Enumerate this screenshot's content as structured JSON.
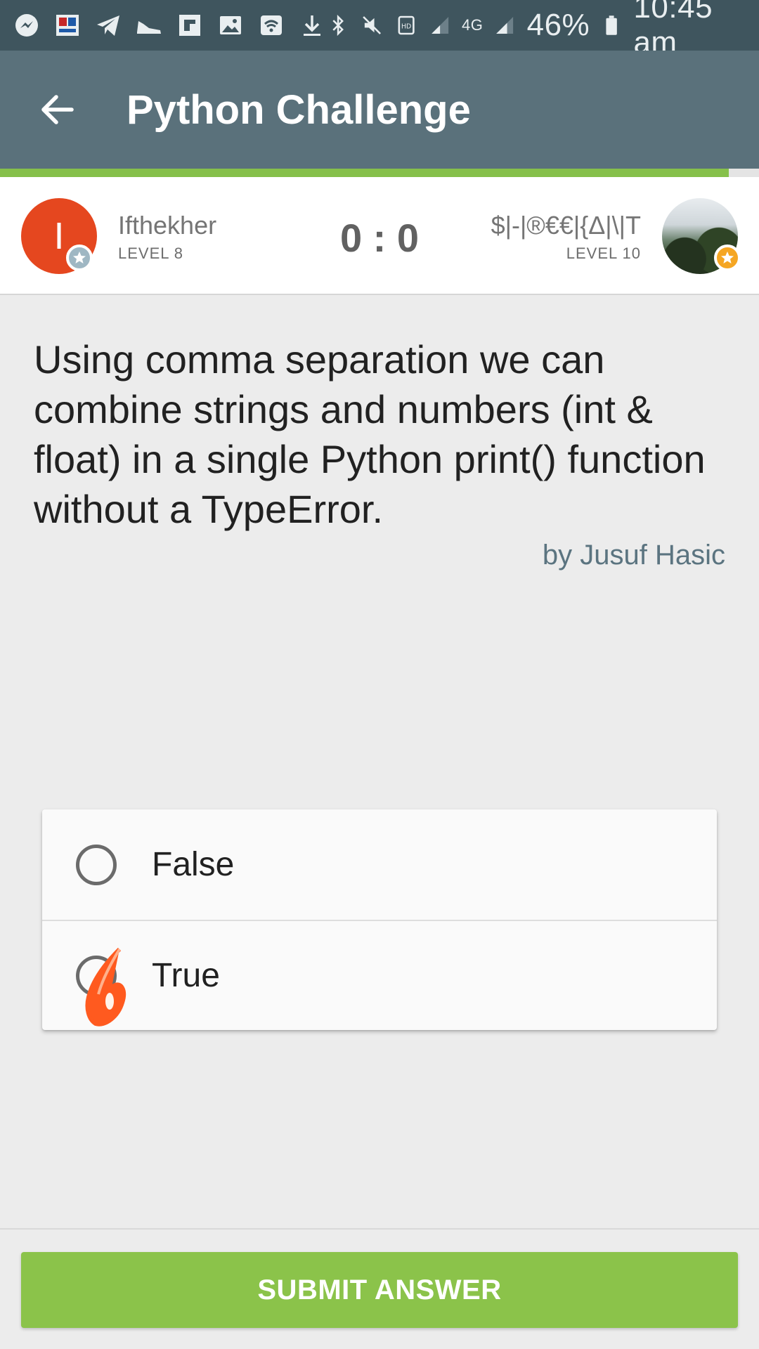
{
  "status_bar": {
    "battery": "46%",
    "time": "10:45 am",
    "network": "4G",
    "icons": [
      "messenger-icon",
      "news-app-icon",
      "telegram-icon",
      "shoe-icon",
      "flipboard-icon",
      "gallery-icon",
      "wifi-icon",
      "download-icon",
      "bluetooth-icon",
      "mute-icon",
      "hd-icon",
      "signal-icon",
      "battery-icon"
    ]
  },
  "app_bar": {
    "title": "Python Challenge",
    "back_icon": "arrow-left-icon"
  },
  "progress": {
    "value": 0.96
  },
  "players": {
    "left": {
      "name": "Ifthekher",
      "level": "LEVEL 8",
      "initial": "I",
      "avatar_color": "#e5471f",
      "badge_color": "#9fb7c3"
    },
    "right": {
      "name": "$|-|®€€|{Δ|\\|T",
      "level": "LEVEL 10",
      "badge_color": "#f5a623"
    },
    "score": "0 : 0"
  },
  "question": {
    "text": "Using comma separation we can combine strings and numbers (int & float) in a single Python print() function without a TypeError.",
    "author": "by Jusuf Hasic"
  },
  "answers": [
    {
      "label": "False",
      "selected": false
    },
    {
      "label": "True",
      "selected": false
    }
  ],
  "submit": {
    "label": "SUBMIT ANSWER",
    "color": "#8bc34a"
  }
}
